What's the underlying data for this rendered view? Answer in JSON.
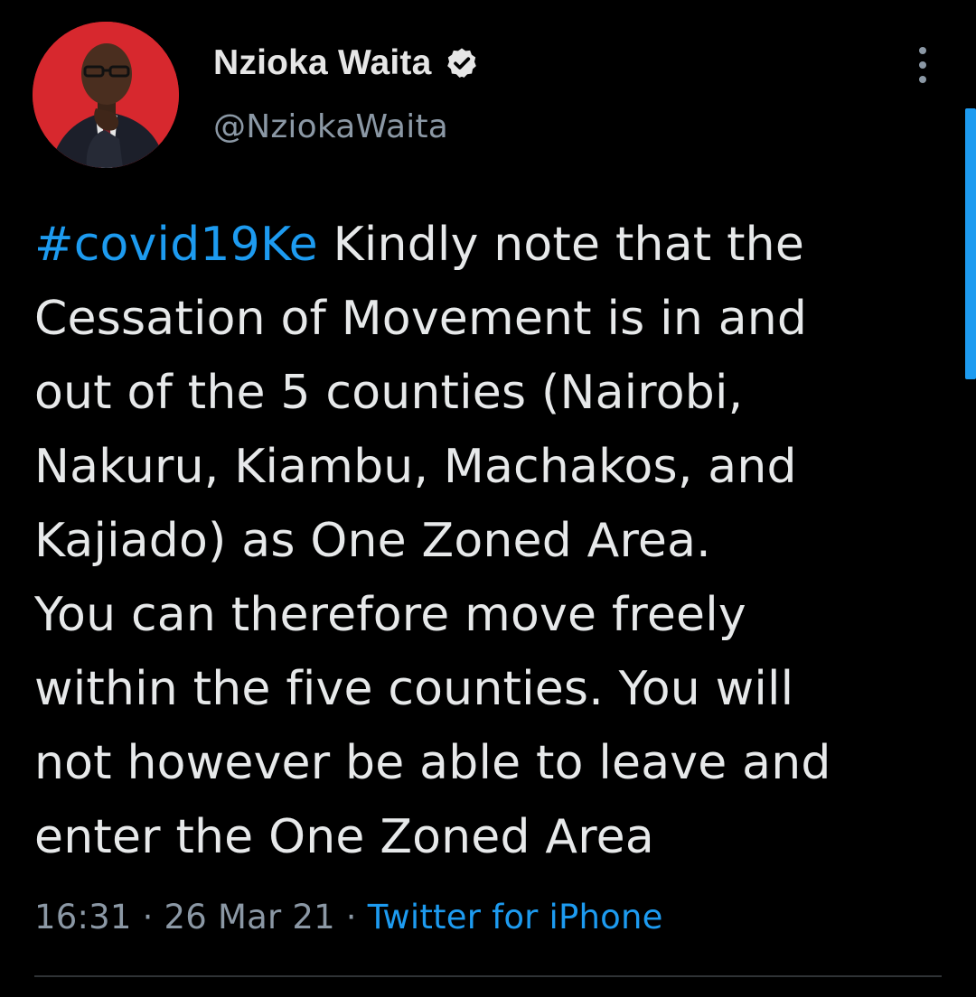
{
  "author": {
    "display_name": "Nzioka Waita",
    "handle": "@NziokaWaita",
    "verified_icon": "verified-badge-icon",
    "avatar_bg": "#d7282e"
  },
  "menu": {
    "icon": "more-vertical-icon"
  },
  "tweet": {
    "hashtag": "#covid19Ke",
    "lines": [
      " Kindly note that the",
      "Cessation of Movement is in and",
      "out of the 5 counties (Nairobi,",
      "Nakuru, Kiambu, Machakos, and",
      "Kajiado) as One Zoned Area.",
      "You can therefore move freely",
      "within the five counties. You will",
      "not however be able to leave and",
      "enter the One Zoned Area"
    ],
    "time": "16:31",
    "separator": " · ",
    "date": "26 Mar 21",
    "source": "Twitter for iPhone"
  },
  "colors": {
    "background": "#000000",
    "accent": "#1d9bf0",
    "text": "#e7e9ea",
    "muted": "#8b98a5"
  }
}
